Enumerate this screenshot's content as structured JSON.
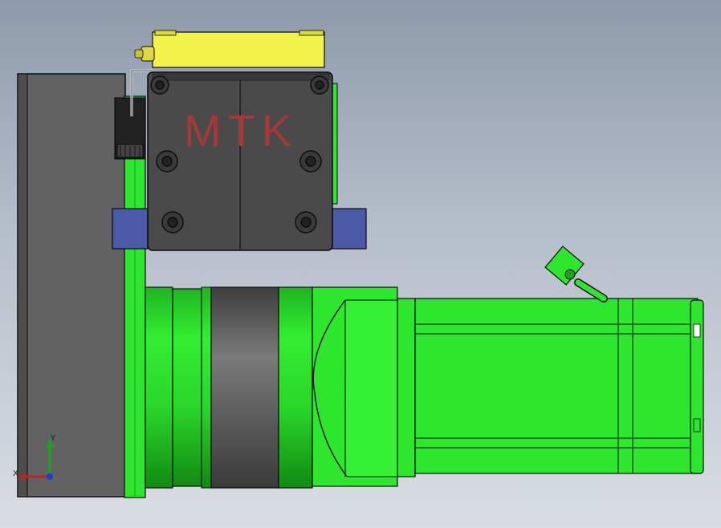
{
  "model": {
    "label": "MTK",
    "label_color": "#a23a3a",
    "palette": {
      "background_top": "#8e9aab",
      "background_bottom": "#d9dde3",
      "plate": "#5f5f5f",
      "motor_green": "#2ee62e",
      "motor_green_dark": "#0f8f0f",
      "gear_box_dark": "#4a4a4a",
      "sensor_yellow": "#f2f24a",
      "clamp_blue": "#4a5aa8",
      "edge": "#0b0b0b"
    },
    "icons": [
      "coordinate-triad-icon"
    ]
  },
  "triad": {
    "x_label": "X",
    "y_label": "Y"
  }
}
